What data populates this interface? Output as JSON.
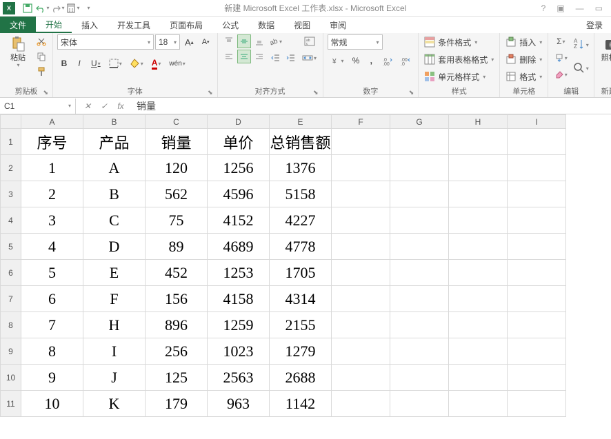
{
  "title": "新建 Microsoft Excel 工作表.xlsx - Microsoft Excel",
  "tabs": {
    "file": "文件",
    "home": "开始",
    "insert": "插入",
    "dev": "开发工具",
    "layout": "页面布局",
    "formulas": "公式",
    "data": "数据",
    "view": "视图",
    "review": "审阅"
  },
  "login": "登录",
  "groups": {
    "clipboard": "剪贴板",
    "paste": "粘贴",
    "font": "字体",
    "fontName": "宋体",
    "fontSize": "18",
    "align": "对齐方式",
    "number": "数字",
    "numFmt": "常规",
    "styles": "样式",
    "condFmt": "条件格式",
    "tableFmt": "套用表格格式",
    "cellStyle": "单元格样式",
    "cells": "单元格",
    "insertCell": "插入",
    "deleteCell": "删除",
    "formatCell": "格式",
    "editing": "编辑",
    "camera": "照相机",
    "newGroup": "新建组"
  },
  "namebox": "C1",
  "formula": "销量",
  "columns": [
    "A",
    "B",
    "C",
    "D",
    "E",
    "F",
    "G",
    "H",
    "I"
  ],
  "rows": [
    "1",
    "2",
    "3",
    "4",
    "5",
    "6",
    "7",
    "8",
    "9",
    "10",
    "11"
  ],
  "cells": {
    "r1": [
      "序号",
      "产品",
      "销量",
      "单价",
      "总销售额",
      "",
      "",
      "",
      ""
    ],
    "r2": [
      "1",
      "A",
      "120",
      "1256",
      "1376",
      "",
      "",
      "",
      ""
    ],
    "r3": [
      "2",
      "B",
      "562",
      "4596",
      "5158",
      "",
      "",
      "",
      ""
    ],
    "r4": [
      "3",
      "C",
      "75",
      "4152",
      "4227",
      "",
      "",
      "",
      ""
    ],
    "r5": [
      "4",
      "D",
      "89",
      "4689",
      "4778",
      "",
      "",
      "",
      ""
    ],
    "r6": [
      "5",
      "E",
      "452",
      "1253",
      "1705",
      "",
      "",
      "",
      ""
    ],
    "r7": [
      "6",
      "F",
      "156",
      "4158",
      "4314",
      "",
      "",
      "",
      ""
    ],
    "r8": [
      "7",
      "H",
      "896",
      "1259",
      "2155",
      "",
      "",
      "",
      ""
    ],
    "r9": [
      "8",
      "I",
      "256",
      "1023",
      "1279",
      "",
      "",
      "",
      ""
    ],
    "r10": [
      "9",
      "J",
      "125",
      "2563",
      "2688",
      "",
      "",
      "",
      ""
    ],
    "r11": [
      "10",
      "K",
      "179",
      "963",
      "1142",
      "",
      "",
      "",
      ""
    ]
  }
}
